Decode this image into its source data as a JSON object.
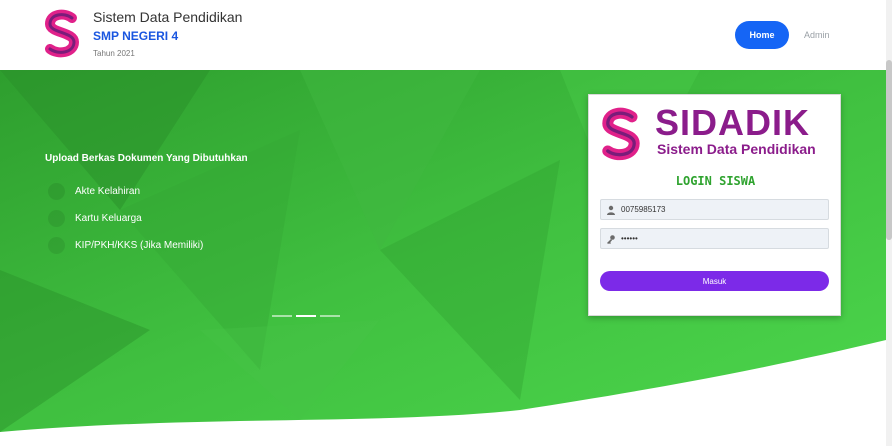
{
  "header": {
    "title": "Sistem Data Pendidikan",
    "school": "SMP NEGERI 4",
    "year": "Tahun 2021",
    "nav": {
      "home_label": "Home",
      "admin_label": "Admin"
    }
  },
  "hero": {
    "upload_title": "Upload Berkas Dokumen Yang Dibutuhkan",
    "documents": [
      "Akte Kelahiran",
      "Kartu Keluarga",
      "KIP/PKH/KKS (Jika Memiliki)"
    ],
    "carousel_active_index": 1
  },
  "login": {
    "brand": "SIDADIK",
    "brand_subtitle": "Sistem Data Pendidikan",
    "heading": "LOGIN SISWA",
    "username_value": "0075985173",
    "password_value": "••••••",
    "submit_label": "Masuk"
  },
  "icons": {
    "brand": "sidadik-s-logo",
    "user": "user-icon",
    "password": "key-icon"
  },
  "colors": {
    "primary_blue": "#1565f5",
    "brand_magenta": "#8b1c8b",
    "logo_pink": "#e0218a",
    "hero_green": "#3fbf3f",
    "heading_green": "#2fa32f",
    "submit_purple": "#7c2ae8"
  }
}
